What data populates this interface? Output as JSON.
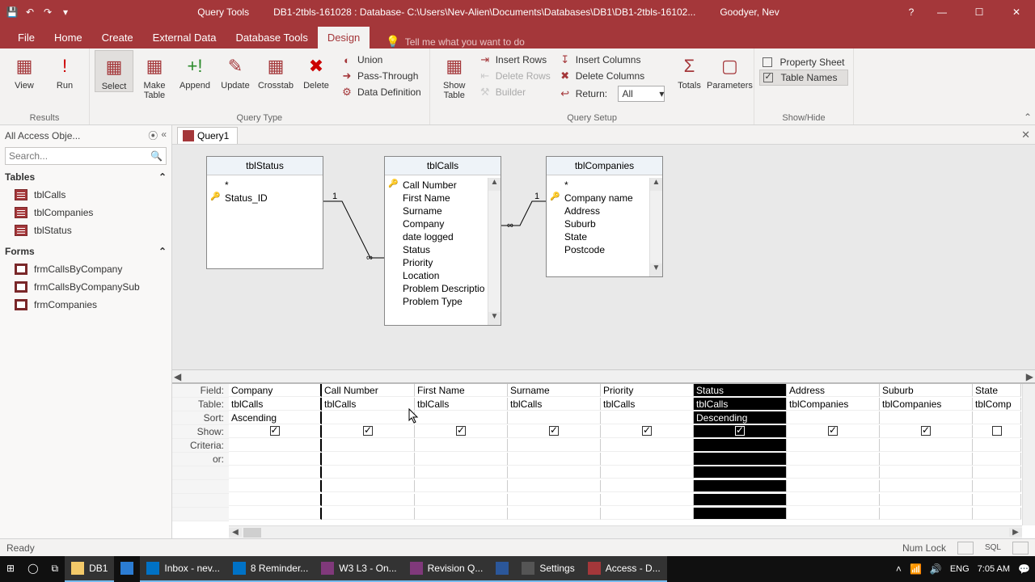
{
  "titlebar": {
    "context": "Query Tools",
    "document": "DB1-2tbls-161028 : Database- C:\\Users\\Nev-Alien\\Documents\\Databases\\DB1\\DB1-2tbls-16102...",
    "user": "Goodyer, Nev"
  },
  "tabs": {
    "file": "File",
    "home": "Home",
    "create": "Create",
    "external": "External Data",
    "dbtools": "Database Tools",
    "design": "Design",
    "tellme": "Tell me what you want to do"
  },
  "ribbon": {
    "results": {
      "label": "Results",
      "view": "View",
      "run": "Run"
    },
    "querytype": {
      "label": "Query Type",
      "select": "Select",
      "maketable": "Make\nTable",
      "append": "Append",
      "update": "Update",
      "crosstab": "Crosstab",
      "delete": "Delete",
      "union": "Union",
      "passthrough": "Pass-Through",
      "datadef": "Data Definition"
    },
    "setup": {
      "label": "Query Setup",
      "showtable": "Show\nTable",
      "insertrows": "Insert Rows",
      "deleterows": "Delete Rows",
      "builder": "Builder",
      "insertcols": "Insert Columns",
      "deletecols": "Delete Columns",
      "return": "Return:",
      "return_value": "All",
      "totals": "Totals",
      "parameters": "Parameters"
    },
    "showhide": {
      "label": "Show/Hide",
      "propsheet": "Property Sheet",
      "tablenames": "Table Names"
    }
  },
  "nav": {
    "title": "All Access Obje...",
    "search_placeholder": "Search...",
    "groups": {
      "tables": {
        "title": "Tables",
        "items": [
          "tblCalls",
          "tblCompanies",
          "tblStatus"
        ]
      },
      "forms": {
        "title": "Forms",
        "items": [
          "frmCallsByCompany",
          "frmCallsByCompanySub",
          "frmCompanies"
        ]
      }
    }
  },
  "doc": {
    "tab": "Query1"
  },
  "tables_on_surface": {
    "tblStatus": {
      "title": "tblStatus",
      "fields": [
        "*",
        "Status_ID"
      ],
      "key_idx": 1
    },
    "tblCalls": {
      "title": "tblCalls",
      "fields": [
        "Call Number",
        "First Name",
        "Surname",
        "Company",
        "date logged",
        "Status",
        "Priority",
        "Location",
        "Problem Descriptio",
        "Problem Type"
      ],
      "key_idx": 0
    },
    "tblCompanies": {
      "title": "tblCompanies",
      "fields": [
        "*",
        "Company name",
        "Address",
        "Suburb",
        "State",
        "Postcode"
      ],
      "key_idx": 1
    }
  },
  "grid": {
    "row_labels": [
      "Field:",
      "Table:",
      "Sort:",
      "Show:",
      "Criteria:",
      "or:"
    ],
    "columns": [
      {
        "field": "Company",
        "table": "tblCalls",
        "sort": "Ascending",
        "show": true
      },
      {
        "field": "Call Number",
        "table": "tblCalls",
        "sort": "",
        "show": true
      },
      {
        "field": "First Name",
        "table": "tblCalls",
        "sort": "",
        "show": true
      },
      {
        "field": "Surname",
        "table": "tblCalls",
        "sort": "",
        "show": true
      },
      {
        "field": "Priority",
        "table": "tblCalls",
        "sort": "",
        "show": true
      },
      {
        "field": "Status",
        "table": "tblCalls",
        "sort": "Descending",
        "show": true,
        "selected": true
      },
      {
        "field": "Address",
        "table": "tblCompanies",
        "sort": "",
        "show": true
      },
      {
        "field": "Suburb",
        "table": "tblCompanies",
        "sort": "",
        "show": true
      },
      {
        "field": "State",
        "table": "tblComp",
        "sort": "",
        "show": false
      }
    ]
  },
  "statusbar": {
    "ready": "Ready",
    "numlock": "Num Lock",
    "sql": "SQL"
  },
  "taskbar": {
    "items": [
      "DB1",
      "Inbox - nev...",
      "8 Reminder...",
      "W3 L3 - On...",
      "Revision Q...",
      "",
      "Settings",
      "Access - D..."
    ],
    "tray": {
      "lang": "ENG",
      "time": "7:05 AM"
    }
  }
}
